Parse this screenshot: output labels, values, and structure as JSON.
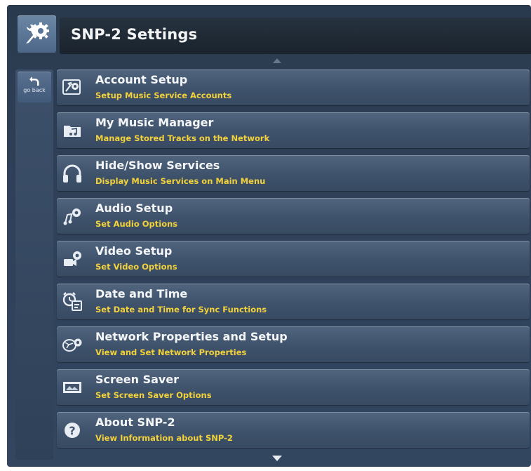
{
  "header": {
    "title": "SNP-2 Settings",
    "logo_icon": "wrench-gear-icon"
  },
  "nav": {
    "back_label": "go back",
    "back_icon": "back-arrow-icon"
  },
  "menu": {
    "items": [
      {
        "title": "Account Setup",
        "subtitle": "Setup Music Service Accounts",
        "icon": "account-setup-icon"
      },
      {
        "title": "My Music Manager",
        "subtitle": "Manage Stored Tracks on the Network",
        "icon": "music-folder-icon"
      },
      {
        "title": "Hide/Show Services",
        "subtitle": "Display Music Services on Main Menu",
        "icon": "headphones-icon"
      },
      {
        "title": "Audio Setup",
        "subtitle": "Set Audio Options",
        "icon": "audio-gear-icon"
      },
      {
        "title": "Video Setup",
        "subtitle": "Set Video Options",
        "icon": "video-camera-gear-icon"
      },
      {
        "title": "Date and Time",
        "subtitle": "Set Date and Time for Sync Functions",
        "icon": "alarm-clock-calendar-icon"
      },
      {
        "title": "Network Properties and Setup",
        "subtitle": "View and Set Network Properties",
        "icon": "network-gear-icon"
      },
      {
        "title": "Screen Saver",
        "subtitle": "Set Screen Saver Options",
        "icon": "screen-saver-icon"
      },
      {
        "title": "About SNP-2",
        "subtitle": "View Information about SNP-2",
        "icon": "question-mark-icon"
      }
    ]
  },
  "colors": {
    "subtitle": "#f2d13a",
    "title": "#f4f6f8",
    "background": "#2f4058"
  }
}
